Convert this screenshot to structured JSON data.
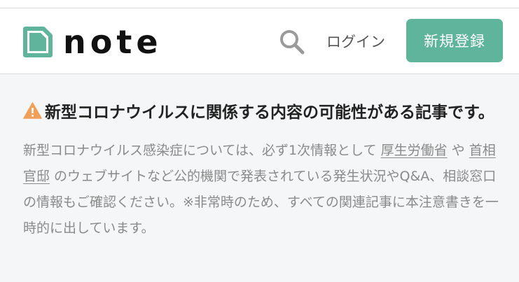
{
  "header": {
    "logo_text": "note",
    "login_label": "ログイン",
    "signup_label": "新規登録",
    "brand_color": "#5fb59b",
    "search_icon": "search-icon"
  },
  "notice": {
    "icon": "warning-icon",
    "icon_color": "#f0a05a",
    "title": "新型コロナウイルスに関係する内容の可能性がある記事です。",
    "body_before": "新型コロナウイルス感染症については、必ず1次情報として ",
    "link1": "厚生労働省",
    "body_mid": " や ",
    "link2": "首相官邸",
    "body_after": " のウェブサイトなど公的機関で発表されている発生状況やQ&A、相談窓口の情報もご確認ください。※非常時のため、すべての関連記事に本注意書きを一時的に出しています。"
  }
}
